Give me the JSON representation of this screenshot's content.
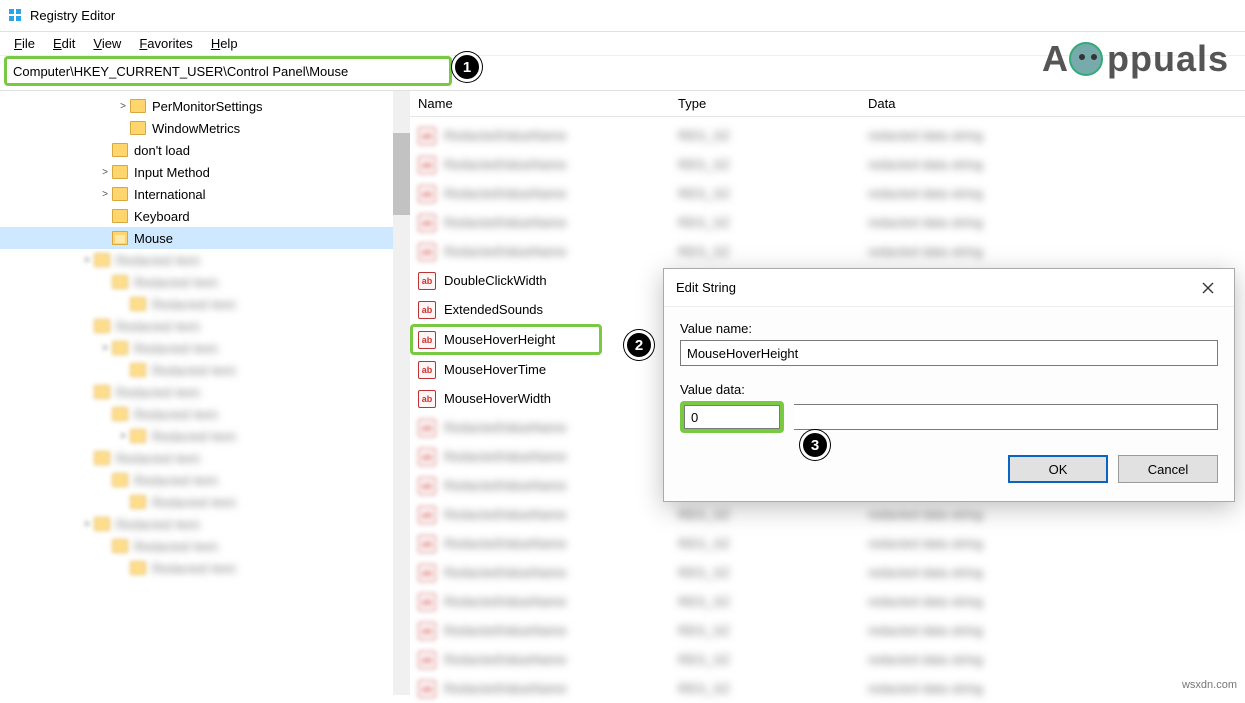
{
  "window": {
    "title": "Registry Editor"
  },
  "menubar": [
    {
      "raw": "File",
      "u": "F",
      "rest": "ile"
    },
    {
      "raw": "Edit",
      "u": "E",
      "rest": "dit"
    },
    {
      "raw": "View",
      "u": "V",
      "rest": "iew"
    },
    {
      "raw": "Favorites",
      "u": "F",
      "rest": "avorites"
    },
    {
      "raw": "Help",
      "u": "H",
      "rest": "elp"
    }
  ],
  "address": "Computer\\HKEY_CURRENT_USER\\Control Panel\\Mouse",
  "tree": {
    "visible": [
      {
        "indent": 6,
        "expander": ">",
        "label": "PerMonitorSettings",
        "selected": false
      },
      {
        "indent": 6,
        "expander": "",
        "label": "WindowMetrics",
        "selected": false
      },
      {
        "indent": 5,
        "expander": "",
        "label": "don't load",
        "selected": false
      },
      {
        "indent": 5,
        "expander": ">",
        "label": "Input Method",
        "selected": false
      },
      {
        "indent": 5,
        "expander": ">",
        "label": "International",
        "selected": false
      },
      {
        "indent": 5,
        "expander": "",
        "label": "Keyboard",
        "selected": false
      },
      {
        "indent": 5,
        "expander": "",
        "label": "Mouse",
        "selected": true
      }
    ],
    "blurred_after_count": 15
  },
  "list": {
    "headers": {
      "name": "Name",
      "type": "Type",
      "data": "Data"
    },
    "rows_before_blur_count": 5,
    "clear_rows": [
      {
        "icon": "str",
        "label": "DoubleClickWidth"
      },
      {
        "icon": "str",
        "label": "ExtendedSounds"
      },
      {
        "icon": "str",
        "label": "MouseHoverHeight",
        "selected": true
      },
      {
        "icon": "str",
        "label": "MouseHoverTime"
      },
      {
        "icon": "str",
        "label": "MouseHoverWidth"
      }
    ],
    "rows_after_blur_count": 10
  },
  "dialog": {
    "title": "Edit String",
    "value_name_label": "Value name:",
    "value_name": "MouseHoverHeight",
    "value_data_label": "Value data:",
    "value_data": "0",
    "ok": "OK",
    "cancel": "Cancel"
  },
  "callouts": {
    "c1": "1",
    "c2": "2",
    "c3": "3"
  },
  "logo_text": "ppuals",
  "watermark": "wsxdn.com"
}
